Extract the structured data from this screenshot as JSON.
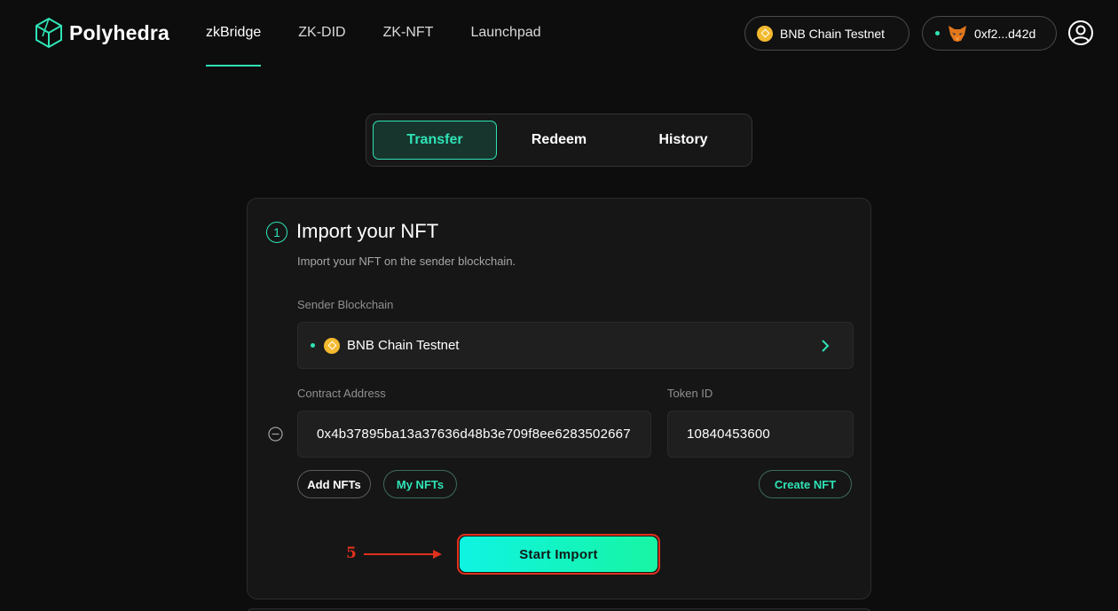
{
  "brand": {
    "name": "Polyhedra",
    "accent": "#2fe3b6"
  },
  "nav": {
    "links": [
      {
        "label": "zkBridge",
        "active": true
      },
      {
        "label": "ZK-DID",
        "active": false
      },
      {
        "label": "ZK-NFT",
        "active": false
      },
      {
        "label": "Launchpad",
        "active": false
      }
    ],
    "network": {
      "label": "BNB Chain Testnet",
      "icon": "bnb-chain-icon"
    },
    "wallet": {
      "address": "0xf2...d42d",
      "icon": "metamask-fox-icon",
      "status": "connected"
    },
    "profile_icon": "user-profile-icon"
  },
  "tabs": [
    {
      "label": "Transfer",
      "active": true
    },
    {
      "label": "Redeem",
      "active": false
    },
    {
      "label": "History",
      "active": false
    }
  ],
  "card": {
    "step": "1",
    "title": "Import your NFT",
    "subtitle": "Import your NFT on the sender blockchain.",
    "sender_label": "Sender Blockchain",
    "sender_value": "BNB Chain Testnet",
    "contract_label": "Contract Address",
    "contract_value": "0x4b37895ba13a37636d48b3e709f8ee6283502667",
    "token_label": "Token ID",
    "token_value": "10840453600",
    "buttons": {
      "add_nfts": "Add NFTs",
      "my_nfts": "My NFTs",
      "create_nft": "Create NFT",
      "start_import": "Start Import"
    }
  },
  "annotation": {
    "step_number": "5",
    "color": "#e0301e"
  }
}
